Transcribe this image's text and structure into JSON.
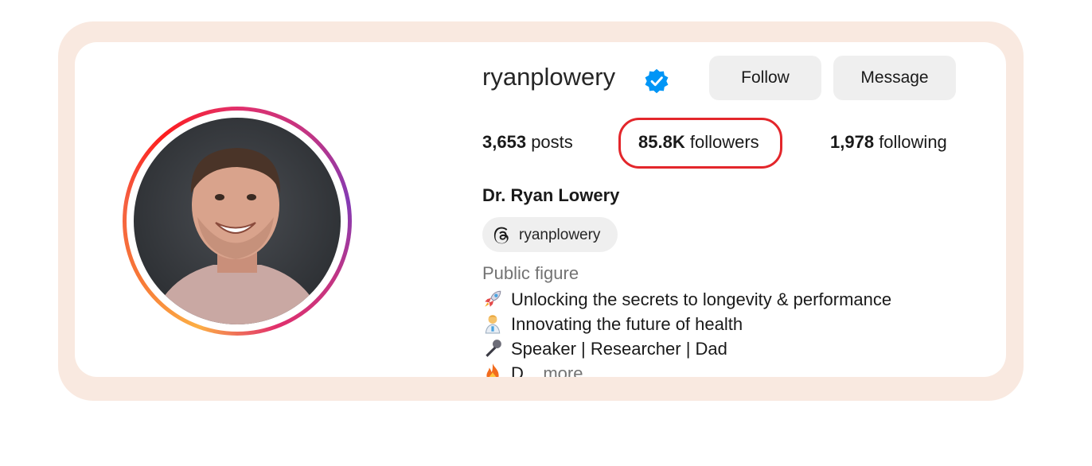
{
  "profile": {
    "username": "ryanplowery",
    "full_name": "Dr. Ryan Lowery",
    "category": "Public figure",
    "verified": true
  },
  "actions": {
    "follow_label": "Follow",
    "message_label": "Message"
  },
  "stats": {
    "posts": "3,653",
    "posts_label": "posts",
    "followers": "85.8K",
    "followers_label": "followers",
    "following": "1,978",
    "following_label": "following"
  },
  "threads": {
    "handle": "ryanplowery",
    "icon": "threads-icon"
  },
  "bio": [
    {
      "icon": "rocket-emoji",
      "text": "Unlocking the secrets to longevity & performance"
    },
    {
      "icon": "scientist-emoji",
      "text": "Innovating the future of health"
    },
    {
      "icon": "microphone-emoji",
      "text": "Speaker | Researcher | Dad"
    },
    {
      "icon": "fire-emoji",
      "text": "D...",
      "more": "more"
    }
  ],
  "colors": {
    "frame": "#f9e9e0",
    "button_bg": "#efefef",
    "verified_blue": "#0095f6",
    "highlight_red": "#e3262b"
  }
}
